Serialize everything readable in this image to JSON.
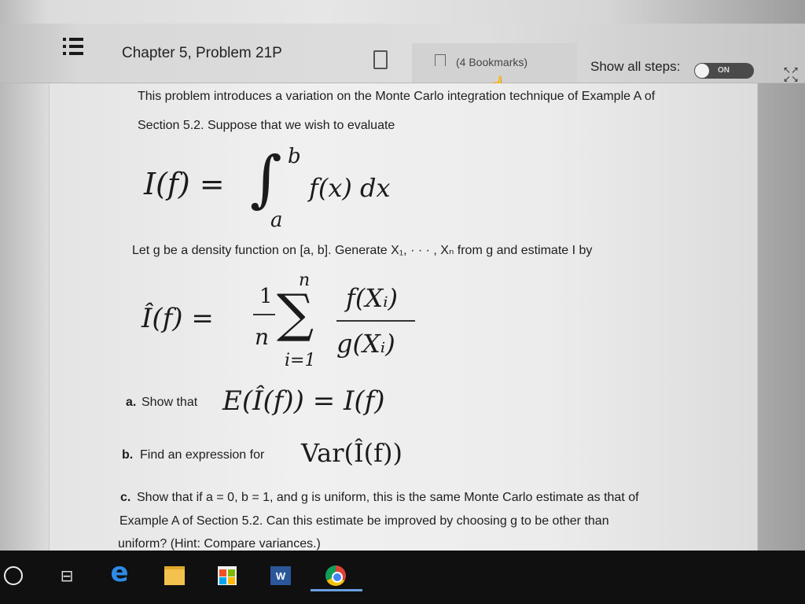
{
  "header": {
    "title": "Chapter 5, Problem 21P",
    "bookmarks_label": "(4 Bookmarks)",
    "show_steps_label": "Show all steps:",
    "toggle_label": "ON"
  },
  "problem": {
    "intro_line1": "This problem introduces a variation on the Monte Carlo integration technique of Example A of",
    "intro_line2": "Section 5.2. Suppose that we wish to evaluate",
    "let_line": "Let g be a density function on [a, b]. Generate X₁, · · · , Xₙ from g and estimate I by",
    "part_a_label": "a.",
    "part_a_text": "Show that",
    "part_b_label": "b.",
    "part_b_text": "Find an expression for",
    "part_c_label": "c.",
    "part_c_line1": "Show that if a = 0, b = 1, and g is uniform, this is the same Monte Carlo estimate as that of",
    "part_c_line2": "Example A of Section 5.2. Can this estimate be improved by choosing g to be other than",
    "part_c_line3": "uniform? (Hint: Compare variances.)"
  },
  "equations": {
    "integral_lhs": "I(f) =",
    "integral_upper": "b",
    "integral_lower": "a",
    "integral_body": "f(x) dx",
    "estimator_lhs": "Î(f) =",
    "frac_num": "1",
    "frac_den": "n",
    "sum_upper": "n",
    "sum_lower": "i=1",
    "ratio_num": "f(Xᵢ)",
    "ratio_den": "g(Xᵢ)",
    "part_a_eq": "E(Î(f)) = I(f)",
    "part_b_eq": "Var(Î(f))"
  },
  "taskbar": {
    "icons": [
      "search-circle-icon",
      "task-view-icon",
      "edge-icon",
      "file-explorer-icon",
      "store-icon",
      "word-icon",
      "chrome-icon"
    ],
    "word_letter": "W"
  }
}
